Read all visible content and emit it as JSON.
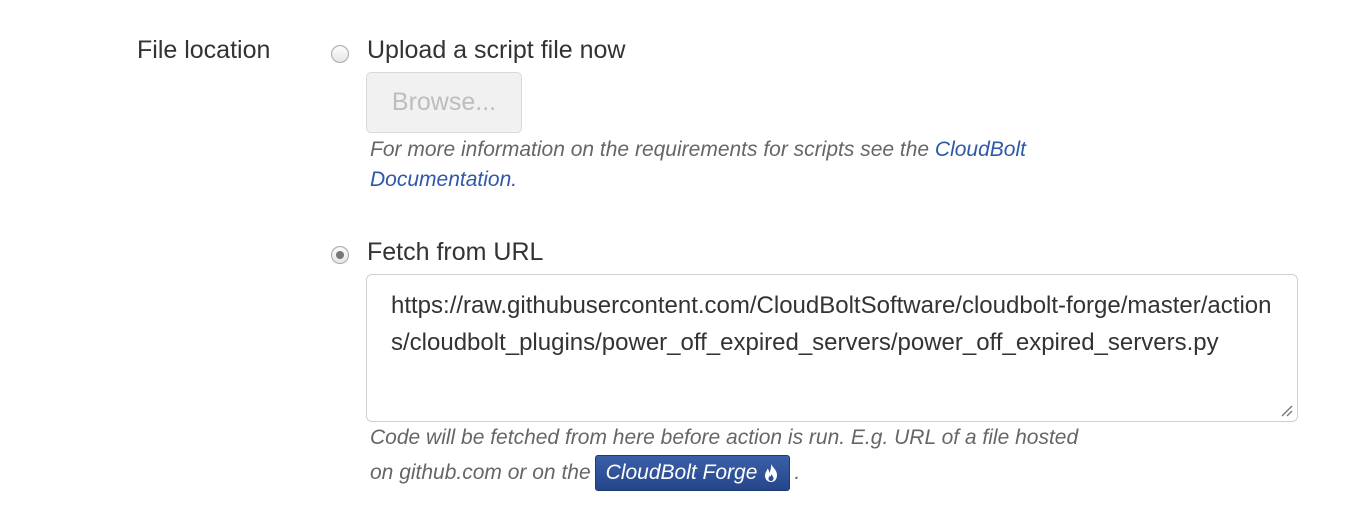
{
  "field_label": "File location",
  "options": {
    "upload": {
      "label": "Upload a script file now",
      "selected": false,
      "browse_label": "Browse...",
      "help_text": "For more information on the requirements for scripts see the",
      "help_link": "CloudBolt Documentation",
      "help_suffix": "."
    },
    "fetch": {
      "label": "Fetch from URL",
      "selected": true,
      "url_value": "https://raw.githubusercontent.com/CloudBoltSoftware/cloudbolt-forge/master/actions/cloudbolt_plugins/power_off_expired_servers/power_off_expired_servers.py",
      "help_line1": "Code will be fetched from here before action is run. E.g. URL of a file hosted",
      "help_line2_prefix": "on github.com or on the",
      "forge_button_label": "CloudBolt Forge",
      "forge_icon": "fire-icon",
      "help_line2_suffix": "."
    }
  },
  "colors": {
    "link": "#2f58a7",
    "forge_button": "#2c4f97"
  }
}
